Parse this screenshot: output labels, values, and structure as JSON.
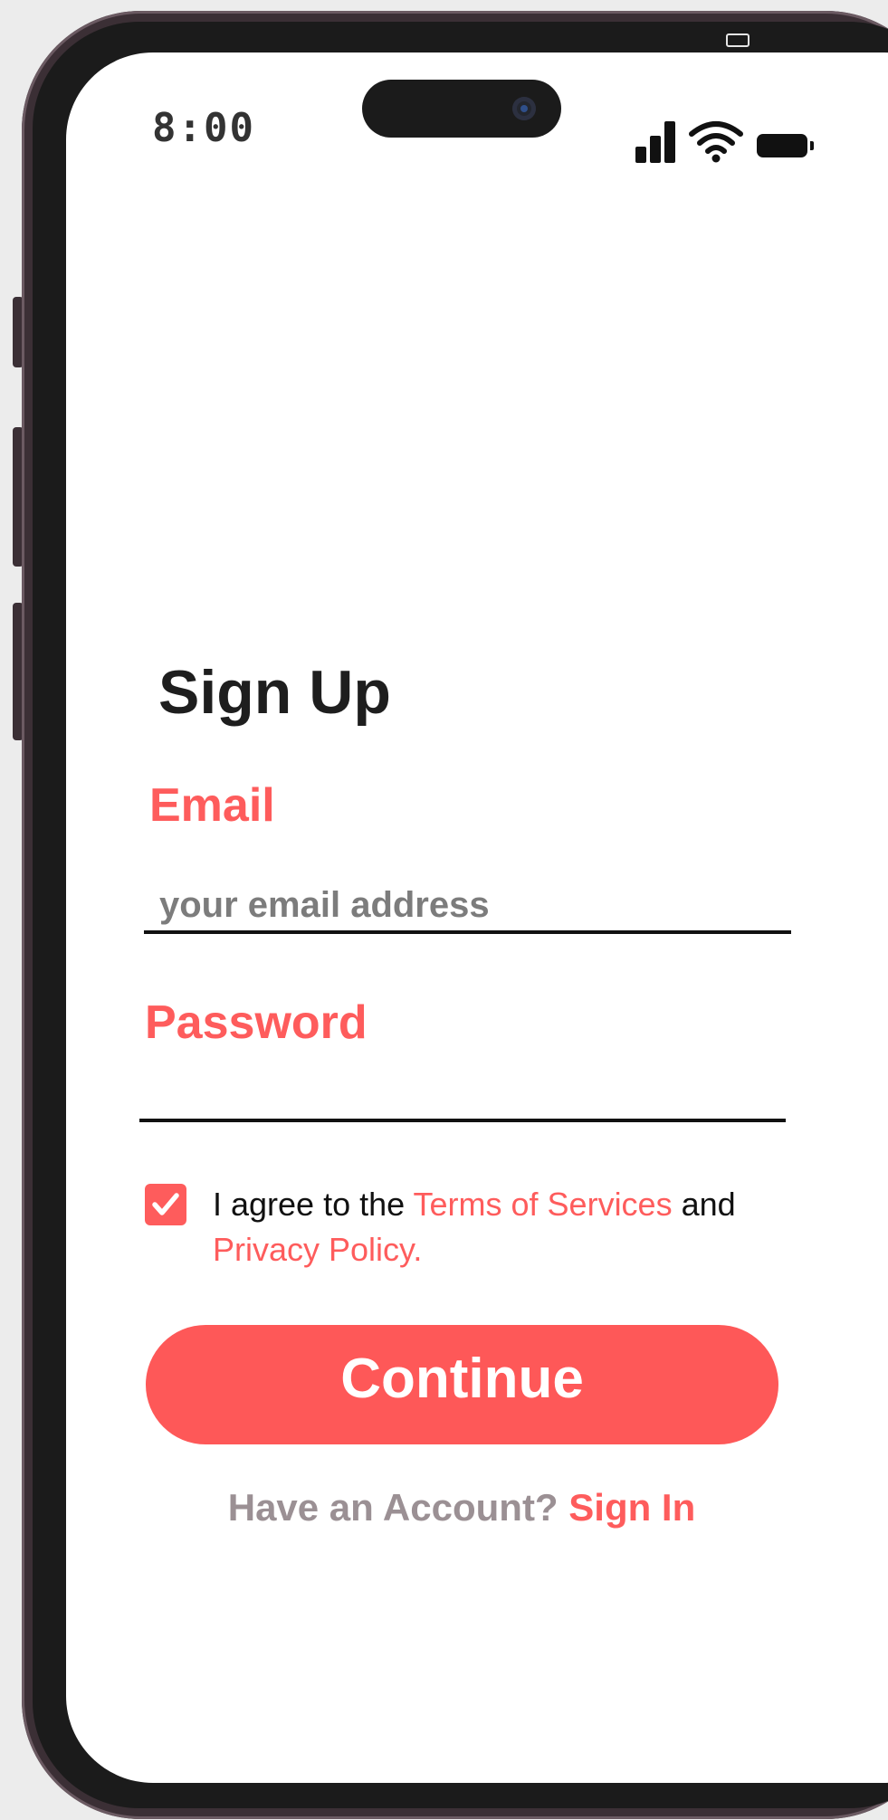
{
  "status_bar": {
    "time": "8:00",
    "icons": [
      "signal-icon",
      "wifi-icon",
      "battery-icon"
    ]
  },
  "form": {
    "title": "Sign Up",
    "email_label": "Email",
    "email_placeholder": "your email address",
    "email_value": "",
    "password_label": "Password",
    "password_value": "",
    "agree": {
      "checked": true,
      "prefix": "I agree to the ",
      "terms_link": "Terms of Services",
      "middle": " and ",
      "privacy_link": "Privacy Policy."
    },
    "continue_label": "Continue",
    "account_prompt": "Have an Account? ",
    "sign_in_link": "Sign In"
  },
  "colors": {
    "accent": "#fe5c5c",
    "button": "#fe5858",
    "heading": "#1e1e1e",
    "muted": "#9b9094",
    "placeholder": "#7c7c7c"
  }
}
